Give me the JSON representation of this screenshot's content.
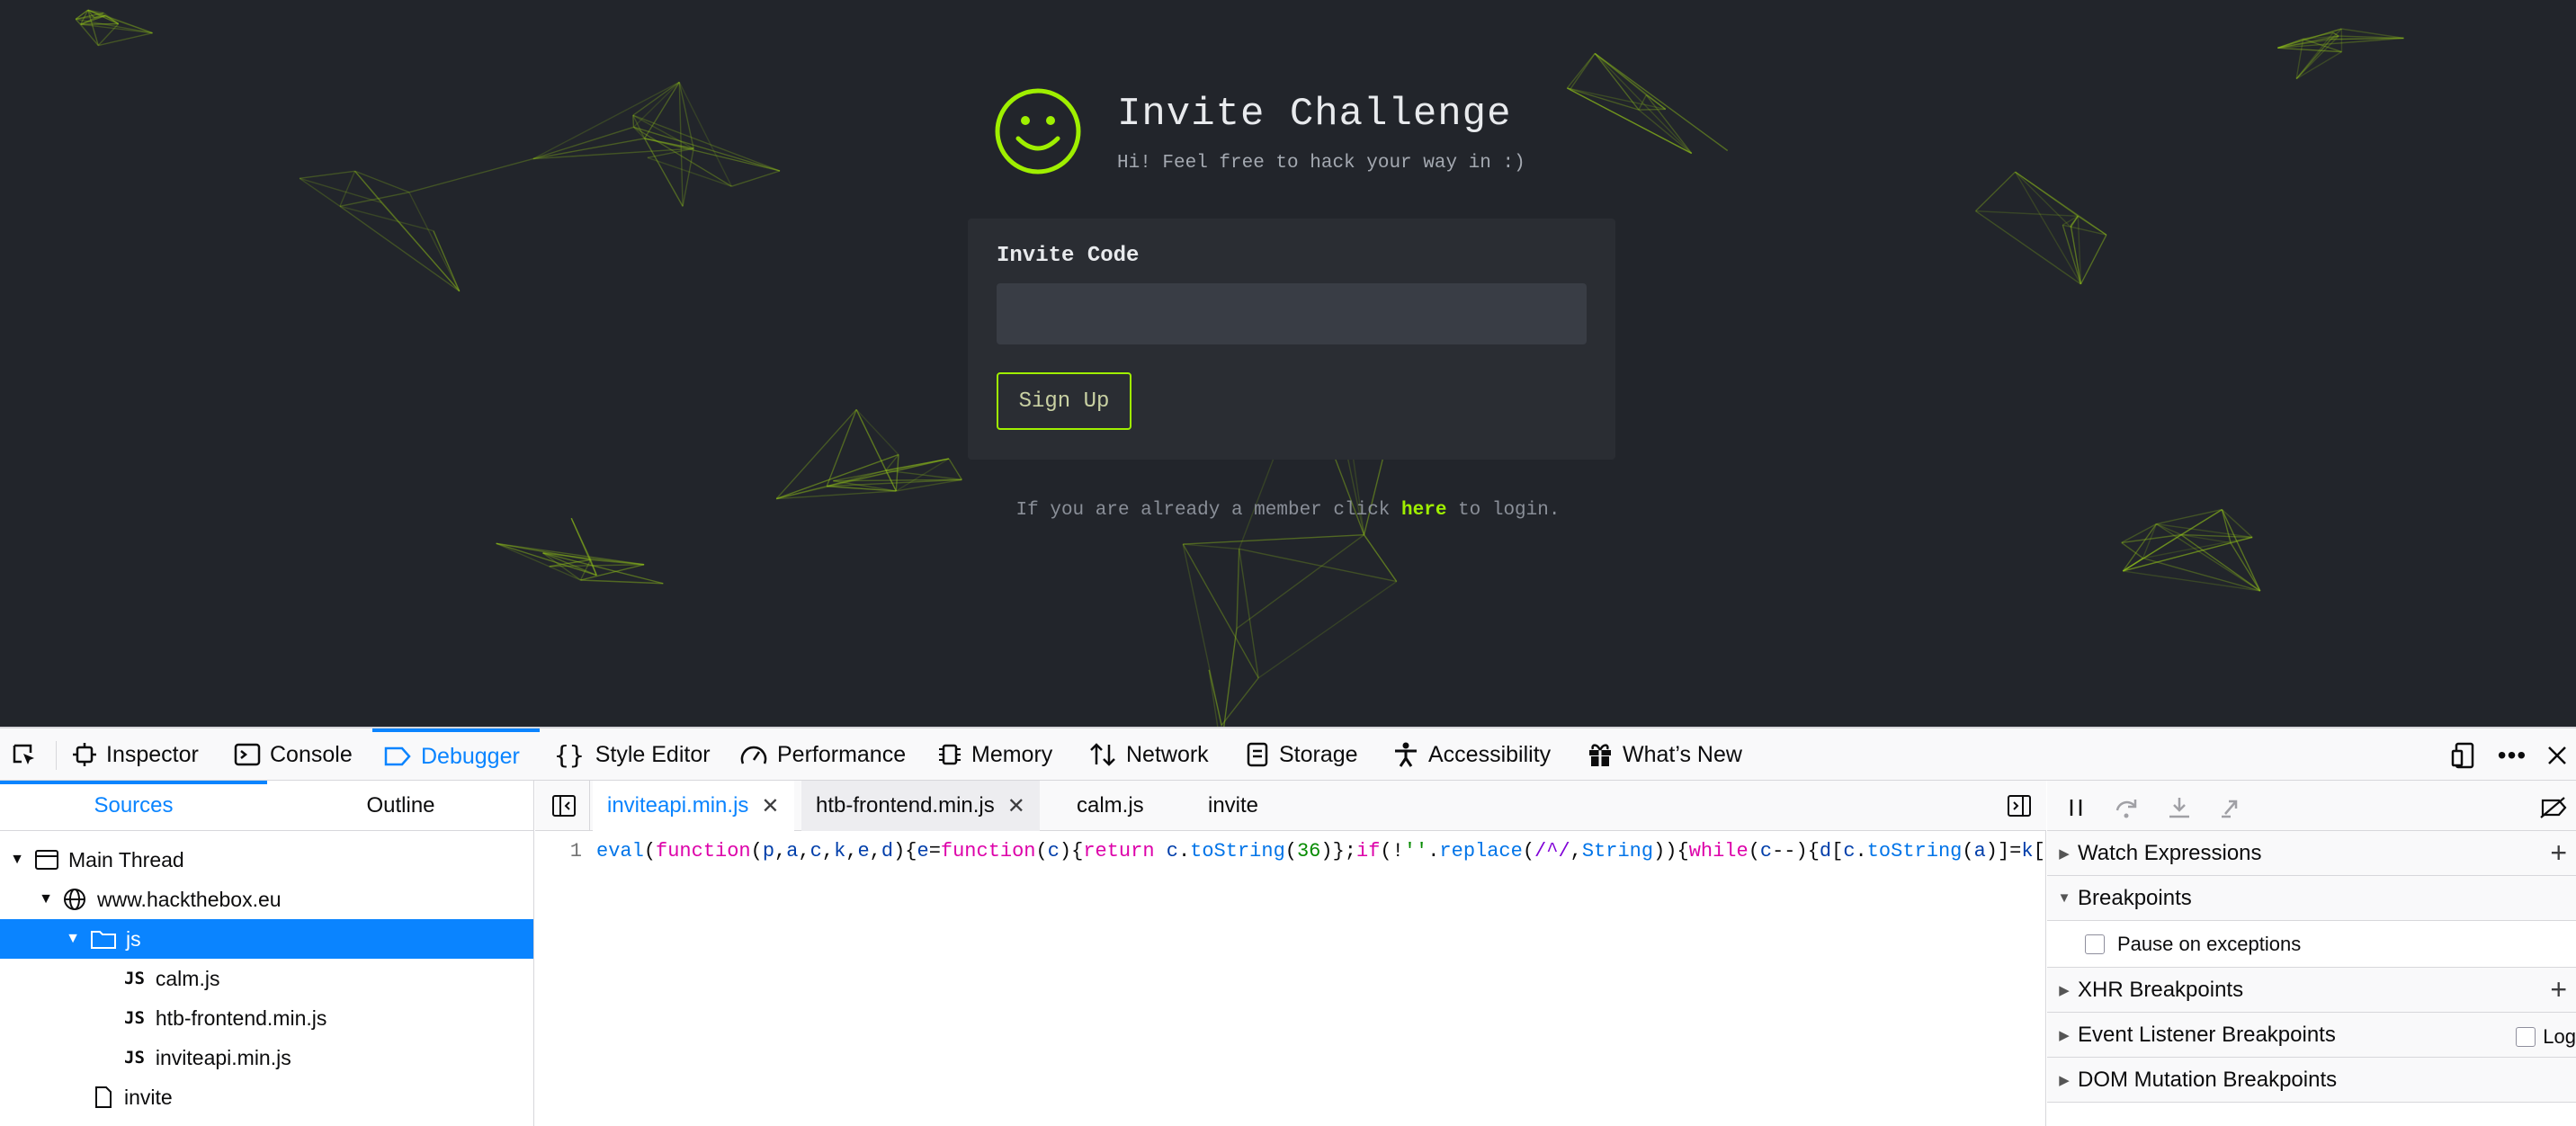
{
  "page": {
    "title": "Invite Challenge",
    "subtitle": "Hi! Feel free to hack your way in :)",
    "form": {
      "code_label": "Invite Code",
      "code_value": "",
      "signup_label": "Sign Up"
    },
    "login_prefix": "If you are already a member click ",
    "login_link": "here",
    "login_suffix": " to login.",
    "accent_color": "#9fef00"
  },
  "devtools": {
    "tools": [
      {
        "label": "Inspector",
        "icon": "inspector-icon"
      },
      {
        "label": "Console",
        "icon": "console-icon"
      },
      {
        "label": "Debugger",
        "icon": "debugger-icon",
        "active": true
      },
      {
        "label": "Style Editor",
        "icon": "braces-icon"
      },
      {
        "label": "Performance",
        "icon": "gauge-icon"
      },
      {
        "label": "Memory",
        "icon": "chip-icon"
      },
      {
        "label": "Network",
        "icon": "arrows-updown-icon"
      },
      {
        "label": "Storage",
        "icon": "storage-icon"
      },
      {
        "label": "Accessibility",
        "icon": "person-icon"
      },
      {
        "label": "What’s New",
        "icon": "gift-icon"
      }
    ],
    "left_tabs": [
      "Sources",
      "Outline"
    ],
    "tree": {
      "thread": "Main Thread",
      "domain": "www.hackthebox.eu",
      "folder": "js",
      "files": [
        "calm.js",
        "htb-frontend.min.js",
        "inviteapi.min.js"
      ],
      "file_badge": "JS",
      "other": "invite"
    },
    "editor_tabs": [
      "inviteapi.min.js",
      "htb-frontend.min.js",
      "calm.js",
      "invite"
    ],
    "line_number": "1",
    "code_tokens": [
      [
        "fn",
        "eval"
      ],
      [
        "",
        "("
      ],
      [
        "kw",
        "function"
      ],
      [
        "",
        "("
      ],
      [
        "id",
        "p"
      ],
      [
        "",
        ","
      ],
      [
        "id",
        "a"
      ],
      [
        "",
        ","
      ],
      [
        "id",
        "c"
      ],
      [
        "",
        ","
      ],
      [
        "id",
        "k"
      ],
      [
        "",
        ","
      ],
      [
        "id",
        "e"
      ],
      [
        "",
        ","
      ],
      [
        "id",
        "d"
      ],
      [
        "",
        "){"
      ],
      [
        "id",
        "e"
      ],
      [
        "",
        "="
      ],
      [
        "kw",
        "function"
      ],
      [
        "",
        "("
      ],
      [
        "id",
        "c"
      ],
      [
        "",
        "){"
      ],
      [
        "kw",
        "return"
      ],
      [
        "",
        " "
      ],
      [
        "id",
        "c"
      ],
      [
        "",
        "."
      ],
      [
        "fn",
        "toString"
      ],
      [
        "",
        "("
      ],
      [
        "str",
        "36"
      ],
      [
        "",
        ")};"
      ],
      [
        "kw",
        "if"
      ],
      [
        "",
        "(!"
      ],
      [
        "str",
        "''"
      ],
      [
        "",
        "."
      ],
      [
        "fn",
        "replace"
      ],
      [
        "",
        "("
      ],
      [
        "re",
        "/^/"
      ],
      [
        "",
        ","
      ],
      [
        "fn",
        "String"
      ],
      [
        "",
        ")){"
      ],
      [
        "kw",
        "while"
      ],
      [
        "",
        "("
      ],
      [
        "id",
        "c"
      ],
      [
        "",
        "--){"
      ],
      [
        "id",
        "d"
      ],
      [
        "",
        "["
      ],
      [
        "id",
        "c"
      ],
      [
        "",
        "."
      ],
      [
        "fn",
        "toString"
      ],
      [
        "",
        "("
      ],
      [
        "id",
        "a"
      ],
      [
        "",
        ")]="
      ],
      [
        "id",
        "k"
      ],
      [
        "",
        "["
      ]
    ],
    "right_panel": {
      "watch": "Watch Expressions",
      "breakpoints": "Breakpoints",
      "pause_exceptions": "Pause on exceptions",
      "xhr": "XHR Breakpoints",
      "event_listener": "Event Listener Breakpoints",
      "log_label": "Log",
      "dom_mutation": "DOM Mutation Breakpoints"
    }
  }
}
